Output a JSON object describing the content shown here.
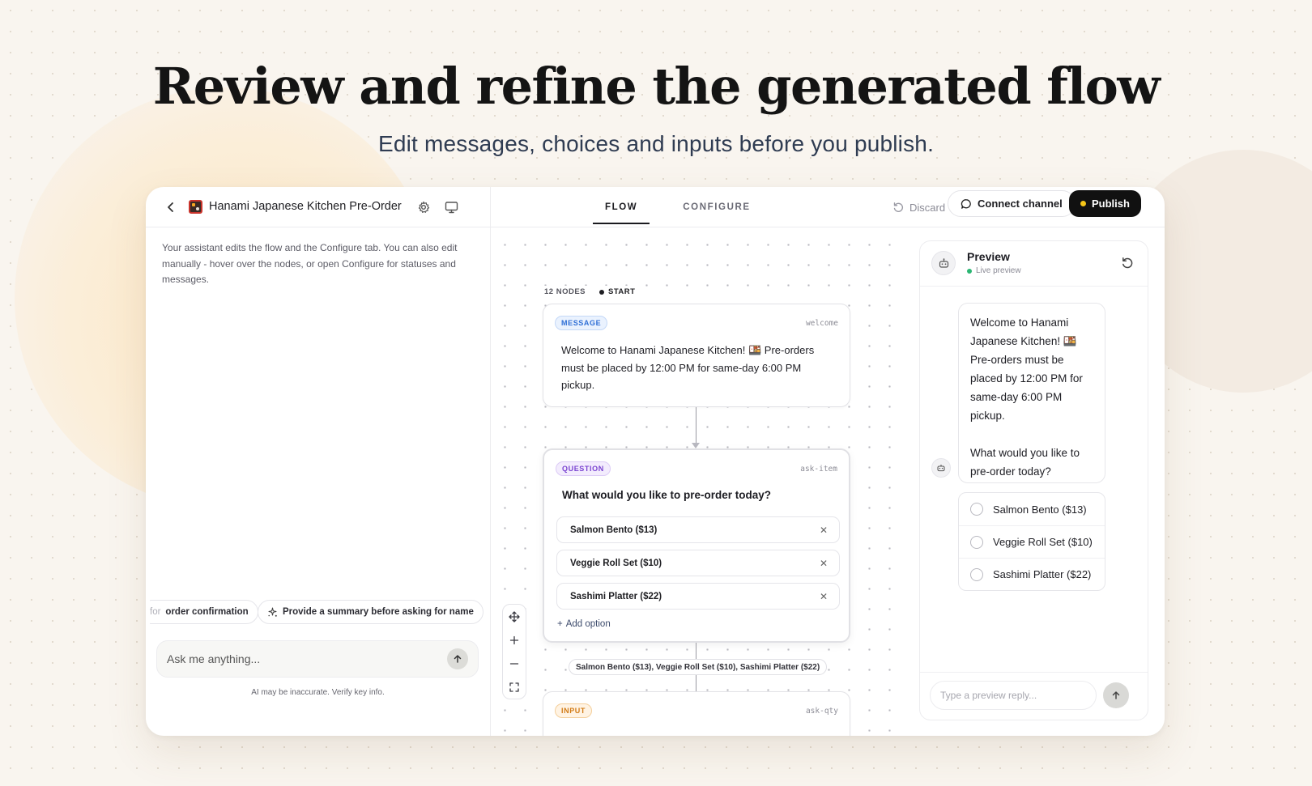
{
  "hero": {
    "title": "Review and refine the generated flow",
    "subtitle": "Edit messages, choices and inputs before you publish."
  },
  "header": {
    "back_icon": "chevron-left-icon",
    "project_title": "Hanami Japanese Kitchen Pre-Order",
    "tabs": [
      {
        "label": "FLOW",
        "active": true
      },
      {
        "label": "CONFIGURE",
        "active": false
      }
    ],
    "discard_label": "Discard",
    "connect_label": "Connect channel",
    "publish_label": "Publish",
    "publish_dot_color": "#f5c518"
  },
  "assistant": {
    "intro": "Your assistant edits the flow and the Configure tab. You can also edit manually - hover over the nodes, or open Configure for statuses and messages.",
    "suggestions": [
      {
        "prefix": "for",
        "label": "order confirmation"
      },
      {
        "label": "Provide a summary before asking for name"
      }
    ],
    "input_placeholder": "Ask me anything...",
    "disclaimer": "AI may be inaccurate. Verify key info."
  },
  "canvas": {
    "node_count": "12 NODES",
    "start_label": "START",
    "nodes": [
      {
        "type": "MESSAGE",
        "id": "welcome",
        "text": "Welcome to Hanami Japanese Kitchen! 🍱 Pre-orders must be placed by 12:00 PM for same-day 6:00 PM pickup."
      },
      {
        "type": "QUESTION",
        "id": "ask-item",
        "question": "What would you like to pre-order today?",
        "options": [
          "Salmon Bento ($13)",
          "Veggie Roll Set ($10)",
          "Sashimi Platter ($22)"
        ],
        "add_option_label": "Add option"
      },
      {
        "type": "INPUT",
        "id": "ask-qty"
      }
    ],
    "edge_label": "Salmon Bento ($13), Veggie Roll Set ($10), Sashimi Platter ($22)",
    "controls": [
      "move-icon",
      "zoom-in-icon",
      "zoom-out-icon",
      "fit-view-icon"
    ]
  },
  "preview": {
    "title": "Preview",
    "status": "Live preview",
    "message_paragraphs": [
      "Welcome to Hanami Japanese Kitchen! 🍱 Pre-orders must be placed by 12:00 PM for same-day 6:00 PM pickup.",
      "What would you like to pre-order today?"
    ],
    "choices": [
      "Salmon Bento ($13)",
      "Veggie Roll Set ($10)",
      "Sashimi Platter ($22)"
    ],
    "reply_placeholder": "Type a preview reply..."
  }
}
